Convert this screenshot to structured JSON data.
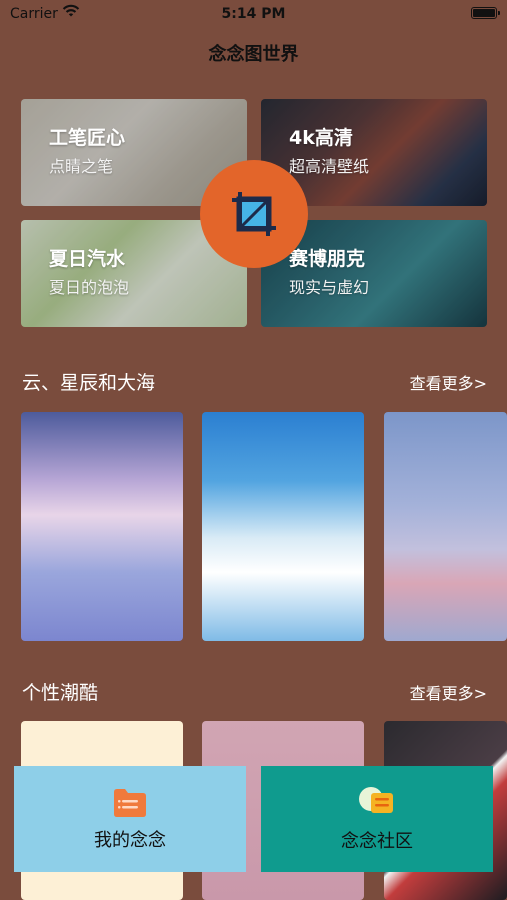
{
  "status_bar": {
    "carrier": "Carrier",
    "time": "5:14 PM"
  },
  "nav": {
    "title": "念念图世界"
  },
  "categories": [
    {
      "title": "工笔匠心",
      "subtitle": "点睛之笔"
    },
    {
      "title": "4k高清",
      "subtitle": "超高清壁纸"
    },
    {
      "title": "夏日汽水",
      "subtitle": "夏日的泡泡"
    },
    {
      "title": "赛博朋克",
      "subtitle": "现实与虚幻"
    }
  ],
  "sections": [
    {
      "title": "云、星辰和大海",
      "more": "查看更多>"
    },
    {
      "title": "个性潮酷",
      "more": "查看更多>"
    }
  ],
  "tabs": {
    "mine": {
      "label": "我的念念",
      "icon": "folder-icon"
    },
    "community": {
      "label": "念念社区",
      "icon": "chat-icon"
    }
  },
  "colors": {
    "background": "#7a4c3d",
    "badge": "#e3652a",
    "tab_mine": "#8ecfe8",
    "tab_community": "#0f9b8e"
  }
}
